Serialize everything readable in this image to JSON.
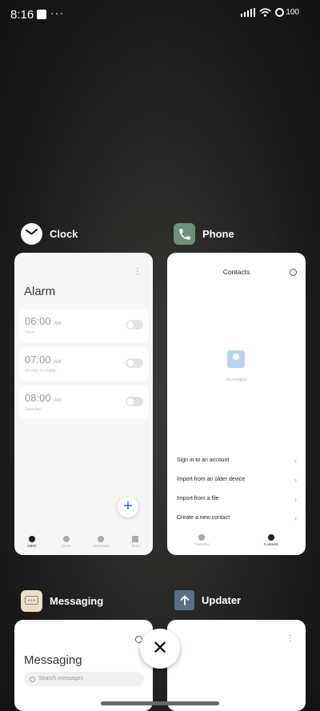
{
  "status": {
    "time": "8:16",
    "battery": "100"
  },
  "apps": {
    "clock": {
      "name": "Clock",
      "title": "Alarm",
      "alarms": [
        {
          "time": "06:00",
          "ampm": "AM",
          "sub": "Once"
        },
        {
          "time": "07:00",
          "ampm": "AM",
          "sub": "Monday to Friday"
        },
        {
          "time": "08:00",
          "ampm": "AM",
          "sub": "Saturday"
        }
      ],
      "tabs": [
        "Alarm",
        "Clock",
        "Stopwatch",
        "Timer"
      ],
      "active_tab": "Alarm"
    },
    "phone": {
      "name": "Phone",
      "title": "Contacts",
      "empty_text": "No contacts",
      "actions": [
        "Sign in to an account",
        "Import from an older device",
        "Import from a file",
        "Create a new contact"
      ],
      "tabs": [
        "Favorites",
        "Contacts"
      ],
      "active_tab": "Contacts"
    },
    "messaging": {
      "name": "Messaging",
      "title": "Messaging",
      "search_placeholder": "Search messages"
    },
    "updater": {
      "name": "Updater"
    }
  },
  "colors": {
    "accent": "#1a73e8",
    "phone_icon": "#6f8f7a",
    "updater_icon": "#5a6f85"
  }
}
